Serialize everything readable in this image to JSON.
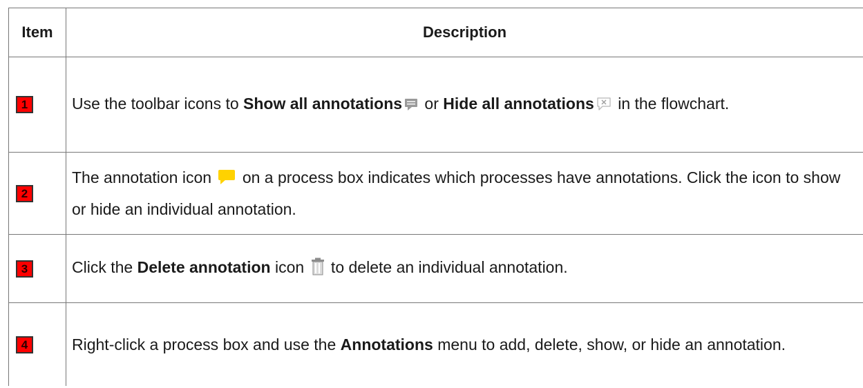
{
  "table": {
    "header": {
      "item": "Item",
      "description": "Description"
    },
    "rows": [
      {
        "number": "1",
        "text_1": "Use the toolbar icons to ",
        "bold_1": "Show all annotations",
        "icon_1": "show-annotations-icon",
        "text_2": " or ",
        "bold_2": "Hide all annotations",
        "icon_2": "hide-annotations-icon",
        "text_3": " in the flowchart."
      },
      {
        "number": "2",
        "text_1": "The annotation icon ",
        "icon_1": "annotation-icon",
        "text_2": " on a process box indicates which processes have annota­tions. Click the icon to show or hide an individual annotation."
      },
      {
        "number": "3",
        "text_1": "Click the ",
        "bold_1": "Delete annotation",
        "text_2": " icon ",
        "icon_1": "delete-annotation-icon",
        "text_3": " to delete an individual annotation."
      },
      {
        "number": "4",
        "text_1": "Right-click a process box and use the ",
        "bold_1": "Annotations",
        "text_2": " menu to add, delete, show, or hide an annotation."
      }
    ]
  },
  "colors": {
    "badge": "#ff0000",
    "border": "#777777",
    "annotation_yellow": "#ffd200"
  }
}
